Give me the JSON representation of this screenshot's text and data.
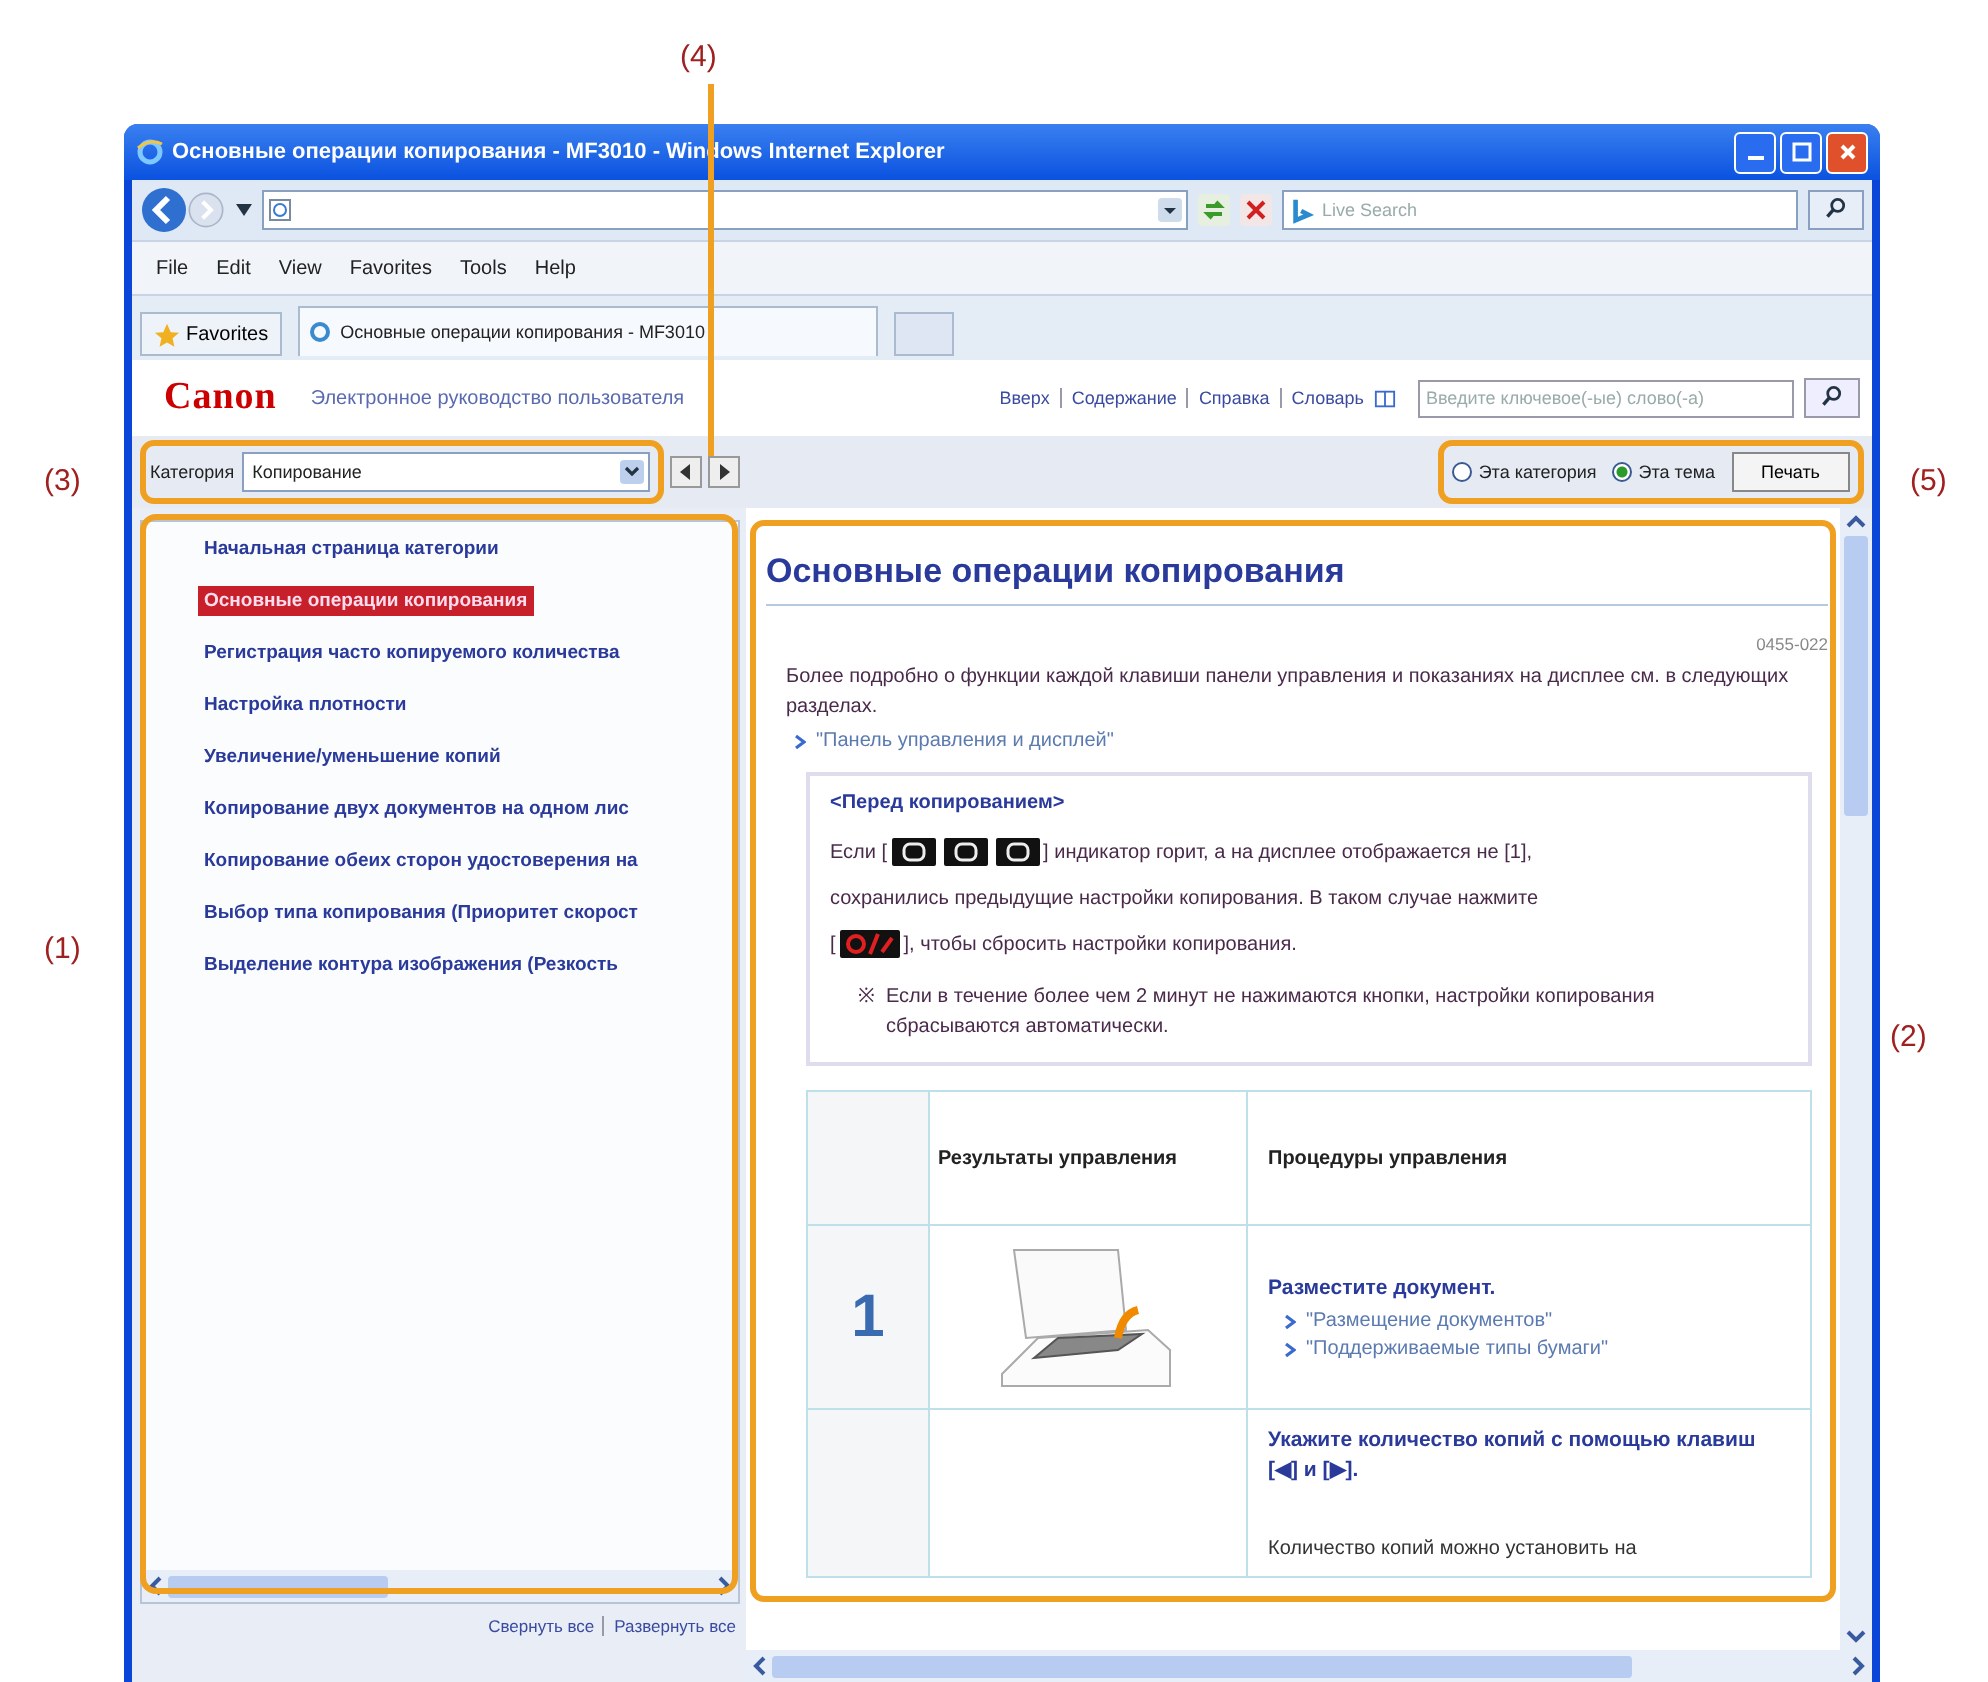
{
  "callouts": {
    "sidebar": "(1)",
    "content": "(2)",
    "category": "(3)",
    "navigation": "(4)",
    "options": "(5)"
  },
  "window": {
    "title": "Основные операции копирования - MF3010 - Windows Internet Explorer"
  },
  "address_bar": {
    "search_placeholder": "Live Search"
  },
  "menu": [
    "File",
    "Edit",
    "View",
    "Favorites",
    "Tools",
    "Help"
  ],
  "favorites_bar": {
    "favorites": "Favorites",
    "tab": "Основные операции копирования - MF3010"
  },
  "header": {
    "logo": "Canon",
    "subtitle": "Электронное руководство пользователя",
    "links": [
      "Вверх",
      "Содержание",
      "Справка",
      "Словарь"
    ],
    "search_placeholder": "Введите ключевое(-ые) слово(-а)"
  },
  "toolbar": {
    "category_label": "Категория",
    "category_value": "Копирование",
    "scope": [
      {
        "label": "Эта категория",
        "selected": false
      },
      {
        "label": "Эта тема",
        "selected": true
      }
    ],
    "print": "Печать"
  },
  "sidebar": {
    "items": [
      {
        "label": "Начальная страница категории",
        "selected": false
      },
      {
        "label": "Основные операции копирования",
        "selected": true
      },
      {
        "label": "Регистрация часто копируемого количества",
        "selected": false
      },
      {
        "label": "Настройка плотности",
        "selected": false
      },
      {
        "label": "Увеличение/уменьшение копий",
        "selected": false
      },
      {
        "label": "Копирование двух документов на одном лис",
        "selected": false
      },
      {
        "label": "Копирование обеих сторон удостоверения на",
        "selected": false
      },
      {
        "label": "Выбор типа копирования (Приоритет скорост",
        "selected": false
      },
      {
        "label": "Выделение контура изображения (Резкость",
        "selected": false
      }
    ],
    "footer_links": [
      "Свернуть все",
      "Развернуть все"
    ]
  },
  "content": {
    "title": "Основные операции копирования",
    "doc_id": "0455-022",
    "intro": "Более подробно о функции каждой клавиши панели управления и показаниях на дисплее см. в следующих разделах.",
    "intro_link": "\"Панель управления и дисплей\"",
    "note": {
      "heading": "<Перед копированием>",
      "lines": [
        [
          {
            "kind": "text",
            "text": "Если ["
          },
          {
            "kind": "key"
          },
          {
            "kind": "key"
          },
          {
            "kind": "key"
          },
          {
            "kind": "text",
            "text": "] индикатор горит, а на дисплее отображается не [1],"
          }
        ],
        [
          {
            "kind": "text",
            "text": "сохранились предыдущие настройки копирования. В таком случае нажмите"
          }
        ],
        [
          {
            "kind": "text",
            "text": "["
          },
          {
            "kind": "reset_key"
          },
          {
            "kind": "text",
            "text": "], чтобы сбросить настройки копирования."
          }
        ]
      ],
      "mark": "※",
      "remark": "Если в течение более чем 2 минут не нажимаются кнопки, настройки копирования сбрасываются автоматически."
    },
    "table": {
      "columns": [
        "Результаты управления",
        "Процедуры управления"
      ],
      "rows": [
        {
          "step": "1",
          "picture": true,
          "title": "Разместите документ.",
          "links": [
            "\"Размещение документов\"",
            "\"Поддерживаемые типы бумаги\""
          ]
        },
        {
          "step": "",
          "picture": false,
          "title": "Укажите количество копий с помощью клавиш [◀] и [▶].",
          "description": "Количество копий можно установить на"
        }
      ]
    }
  }
}
